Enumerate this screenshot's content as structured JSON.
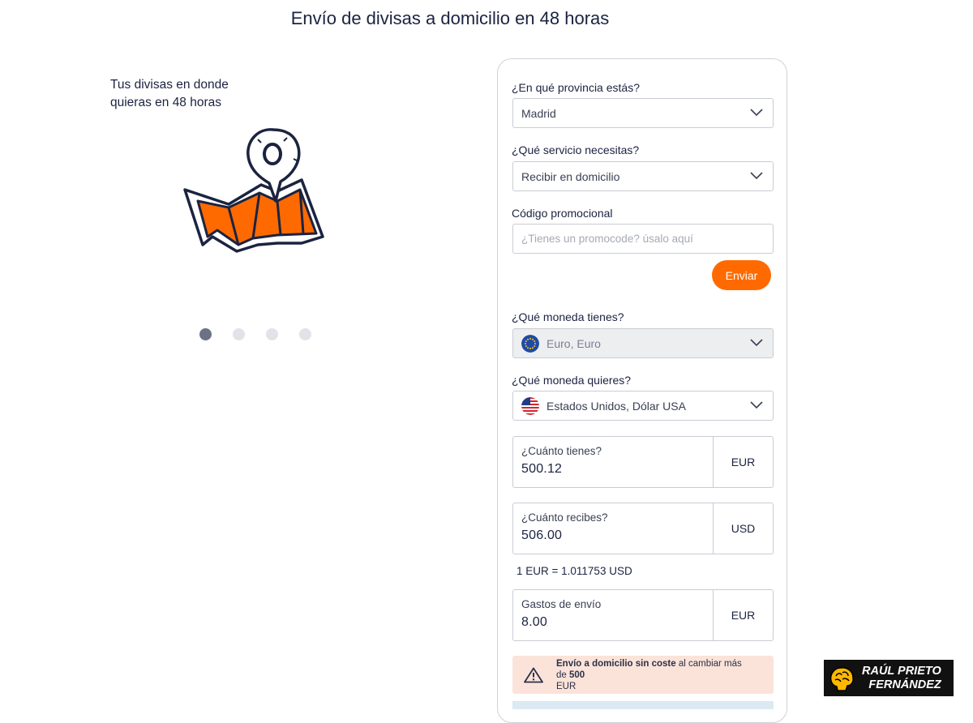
{
  "page": {
    "title": "Envío de divisas a domicilio en 48 horas"
  },
  "promo": {
    "line1": "Tus divisas en donde",
    "line2": "quieras en 48 horas"
  },
  "carousel": {
    "slide_count": 4,
    "active_index": 0
  },
  "form": {
    "province": {
      "label": "¿En qué provincia estás?",
      "value": "Madrid"
    },
    "service": {
      "label": "¿Qué servicio necesitas?",
      "value": "Recibir en domicilio"
    },
    "promo_code": {
      "label": "Código promocional",
      "placeholder": "¿Tienes un promocode? úsalo aquí",
      "button": "Enviar"
    },
    "have_currency": {
      "label": "¿Qué moneda tienes?",
      "value": "Euro, Euro",
      "icon": "eu-flag-icon",
      "disabled": true
    },
    "want_currency": {
      "label": "¿Qué moneda quieres?",
      "value": "Estados Unidos, Dólar USA",
      "icon": "us-flag-icon"
    },
    "have_amount": {
      "label": "¿Cuánto tienes?",
      "value": "500.12",
      "currency": "EUR"
    },
    "receive_amount": {
      "label": "¿Cuánto recibes?",
      "value": "506.00",
      "currency": "USD"
    },
    "rate": "1 EUR = 1.011753 USD",
    "shipping": {
      "label": "Gastos de envío",
      "value": "8.00",
      "currency": "EUR"
    }
  },
  "notice": {
    "icon": "warning-icon",
    "bold1": "Envío a domicilio sin coste",
    "normal": " al cambiar más de ",
    "bold2": "500",
    "line2": "EUR"
  },
  "watermark": {
    "line1": "RAÚL PRIETO",
    "line2": "FERNÁNDEZ"
  },
  "colors": {
    "accent": "#ff6a00",
    "text": "#1b2340",
    "notice_bg": "#fbe3d9",
    "disabled_bg": "#eceef0"
  }
}
